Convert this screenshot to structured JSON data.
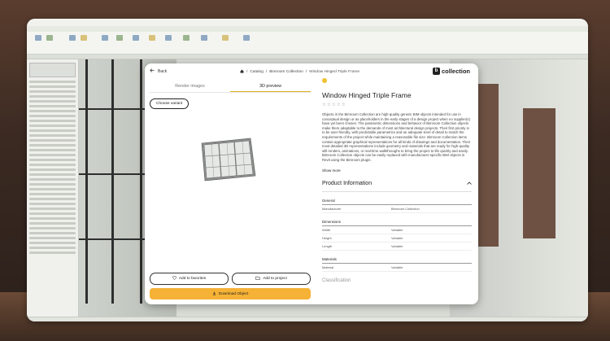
{
  "modal": {
    "back_label": "Back",
    "breadcrumbs": [
      "Catalog",
      "Bimroom Collection",
      "Window Hinged Triple Frame"
    ],
    "brand": "collection",
    "brand_logo_letter": "b",
    "tabs": [
      "Render images",
      "3D preview"
    ],
    "active_tab": "3D preview",
    "variant_button": "Choose variant",
    "favorites_button": "Add to favorites",
    "project_button": "Add to project",
    "download_button": "Download Object",
    "product": {
      "title": "Window Hinged Triple Frame",
      "description": "Objects in the Bimroom Collection are high-quality generic BIM objects intended for use in conceptual design or as placeholders in the early stages of a design project when no supplier(s) have yet been chosen. The parametric dimensions and behavior of Bimroom Collection objects make them adaptable to the demands of most architectural design projects. Their first priority is to be user-friendly, with predictable parametrics and an adequate level of detail to match the requirements of the project while maintaining a reasonable file size. Bimroom Collection items contain appropriate graphical representations for all kinds of drawings and documentation. Their most detailed 3D representations include geometry and materials that are ready for high-quality still renders, animations, or real-time walkthroughs to bring the project to life quickly and easily. Bimroom Collection objects can be easily replaced with manufacturer-specific BIM objects in Revit using the Bimroom plugin.",
      "show_more": "Show more",
      "info_heading": "Product Information",
      "sections": [
        {
          "title": "General",
          "rows": [
            {
              "k": "Manufacturer",
              "v": "Bimroom Collection"
            }
          ]
        },
        {
          "title": "Dimensions",
          "rows": [
            {
              "k": "Width",
              "v": "Variable"
            },
            {
              "k": "Height",
              "v": "Variable"
            },
            {
              "k": "Length",
              "v": "Variable"
            }
          ]
        },
        {
          "title": "Materials",
          "rows": [
            {
              "k": "Material",
              "v": "Variable"
            }
          ]
        }
      ],
      "classification_heading": "Classification"
    }
  },
  "colors": {
    "accent": "#f6b236",
    "tab_underline": "#e3b020"
  },
  "icons": [
    "arrow-left-icon",
    "home-icon",
    "heart-icon",
    "folder-icon",
    "download-icon",
    "chevron-up-icon",
    "chevron-down-icon"
  ]
}
